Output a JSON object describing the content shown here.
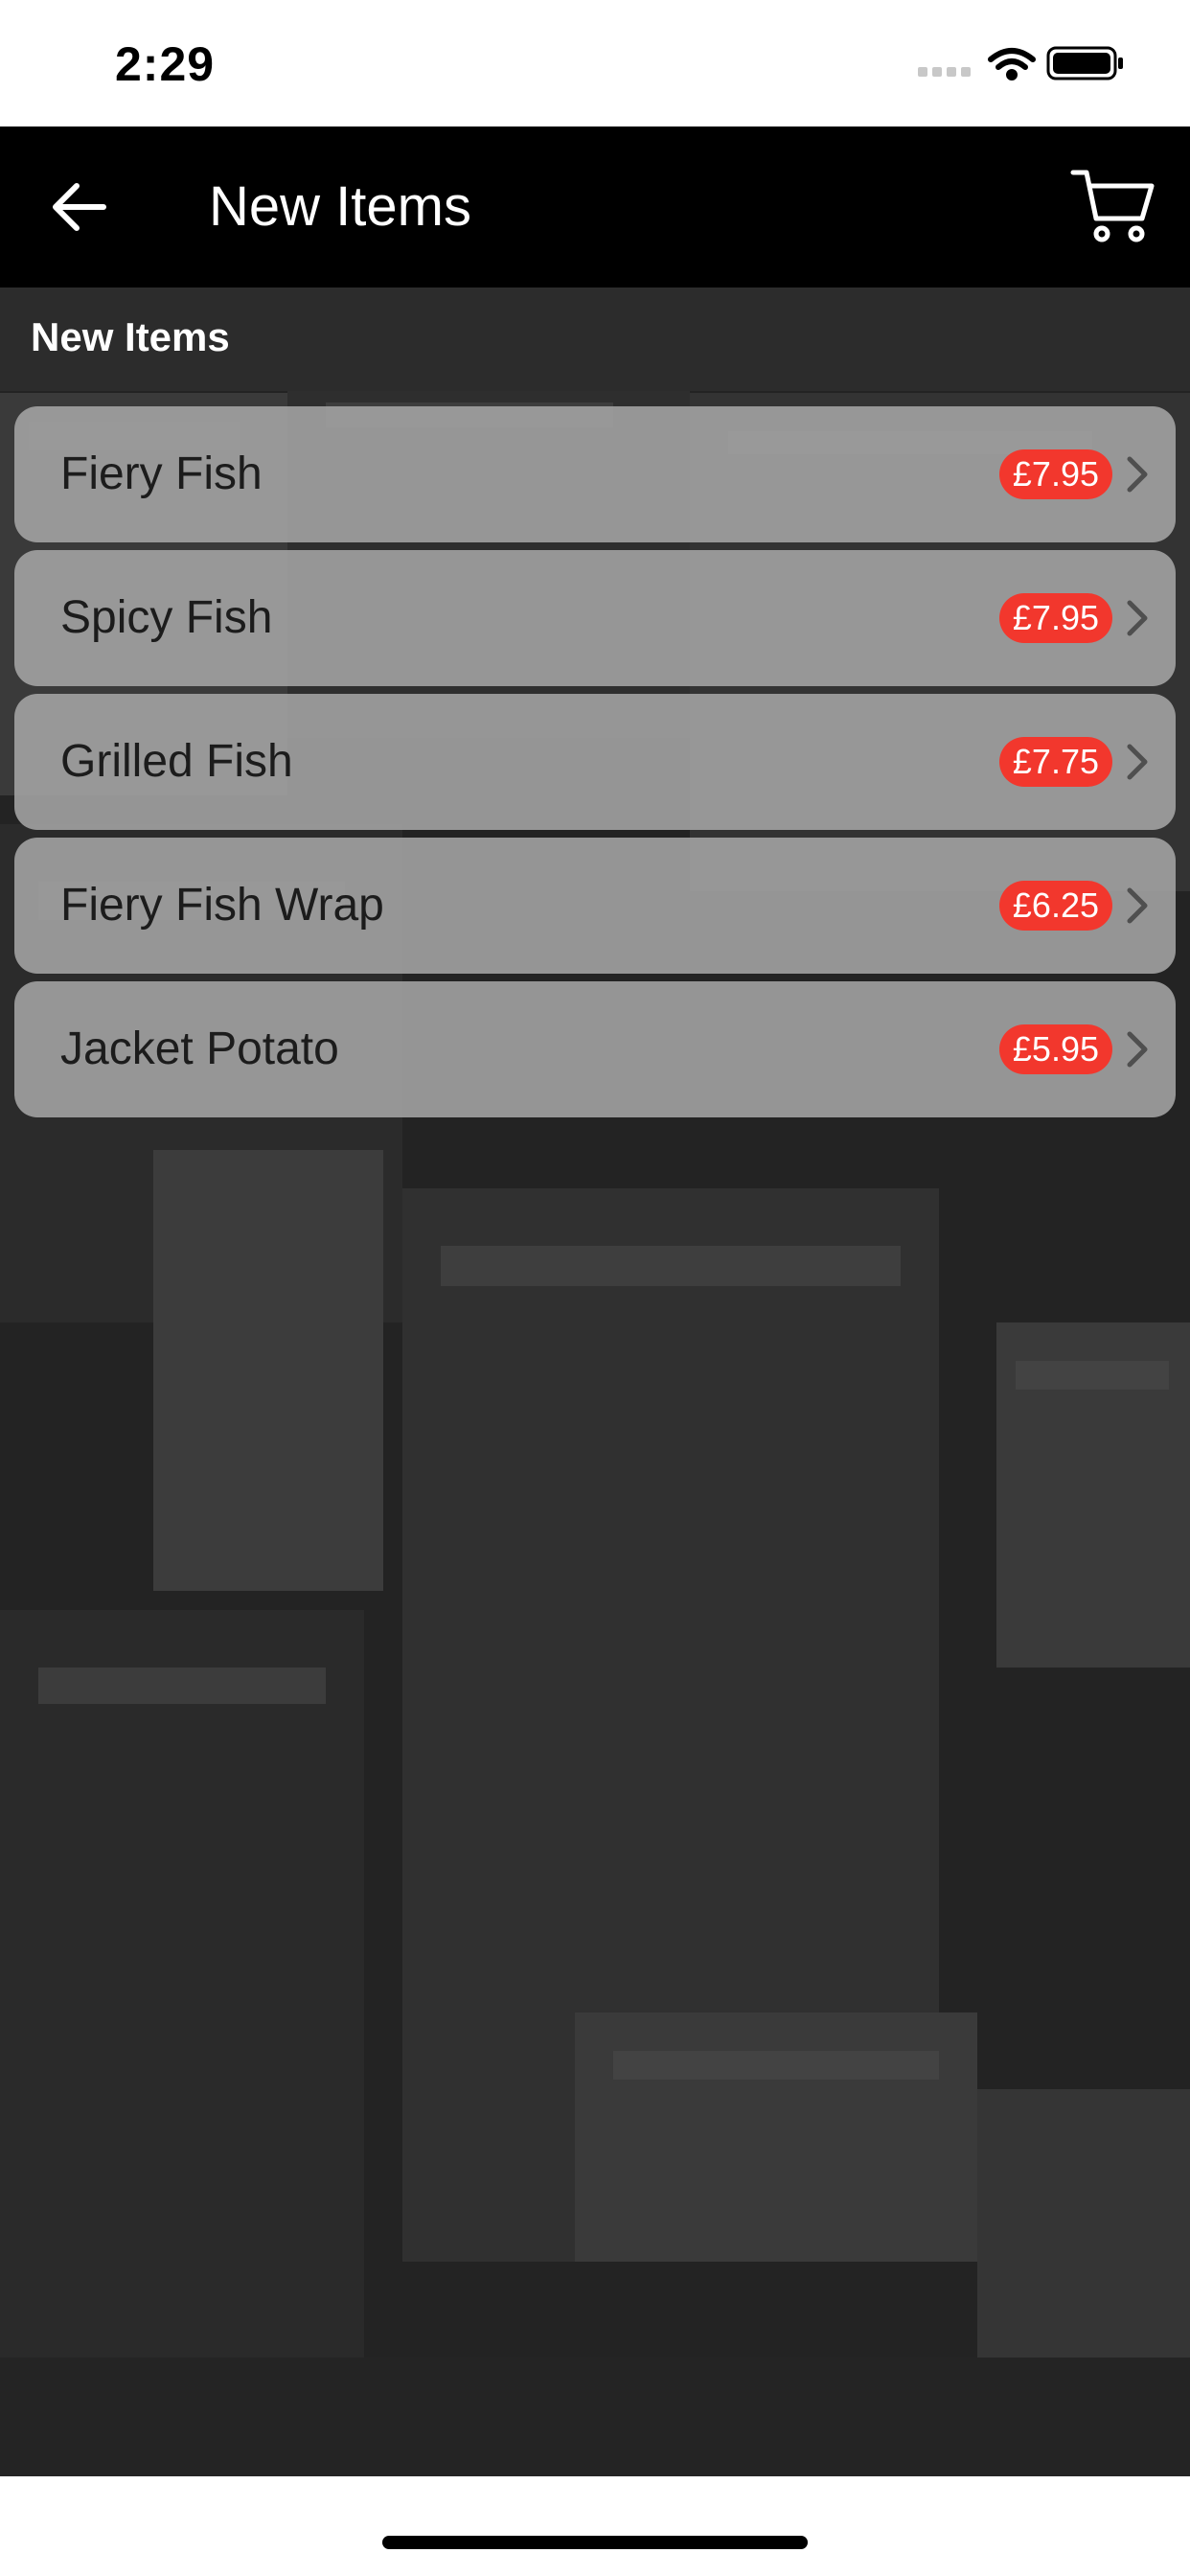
{
  "status_bar": {
    "time": "2:29",
    "icons": [
      "signal-dots-icon",
      "wifi-icon",
      "battery-icon"
    ]
  },
  "nav": {
    "back_icon": "arrow-left-icon",
    "title": "New Items",
    "cart_icon": "cart-icon"
  },
  "section": {
    "label": "New Items"
  },
  "items": [
    {
      "name": "Fiery Fish",
      "price": "£7.95"
    },
    {
      "name": "Spicy Fish",
      "price": "£7.95"
    },
    {
      "name": "Grilled Fish",
      "price": "£7.75"
    },
    {
      "name": "Fiery Fish Wrap",
      "price": "£6.25"
    },
    {
      "name": "Jacket Potato",
      "price": "£5.95"
    }
  ],
  "colors": {
    "nav_background": "#000000",
    "price_badge": "#f2372d",
    "row_background": "#a8a8a8",
    "content_background": "#222222"
  }
}
